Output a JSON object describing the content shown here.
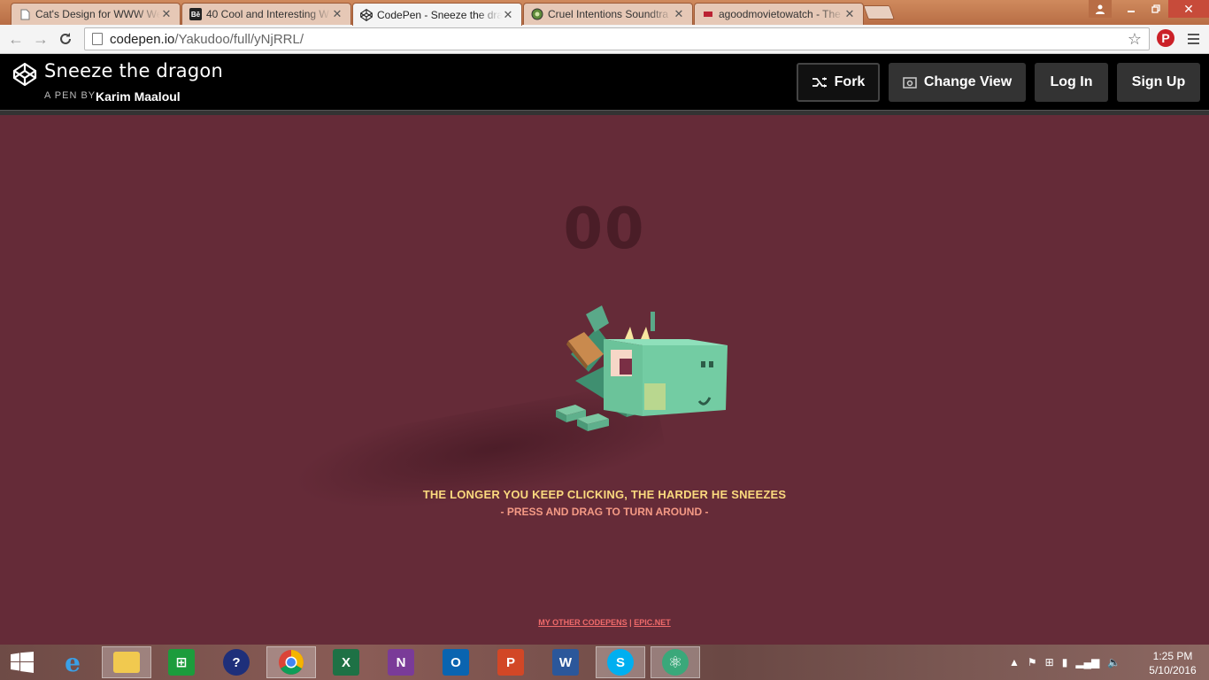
{
  "browser": {
    "tabs": [
      {
        "title": "Cat's Design for WWW We",
        "favicon": "page-icon",
        "active": false
      },
      {
        "title": "40 Cool and Interesting W",
        "favicon": "behance-icon",
        "active": false
      },
      {
        "title": "CodePen - Sneeze the dra",
        "favicon": "codepen-icon",
        "active": true
      },
      {
        "title": "Cruel Intentions Soundtra",
        "favicon": "music-icon",
        "active": false
      },
      {
        "title": "agoodmovietowatch - The",
        "favicon": "movie-icon",
        "active": false
      }
    ],
    "url_host": "codepen.io",
    "url_path": "/Yakudoo/full/yNjRRL/"
  },
  "codepen": {
    "pen_title": "Sneeze the dragon",
    "by_prefix": "A PEN BY",
    "author": "Karim Maaloul",
    "buttons": {
      "fork": "Fork",
      "change_view": "Change View",
      "login": "Log In",
      "signup": "Sign Up"
    }
  },
  "stage": {
    "counter": "00",
    "hint_primary": "THE LONGER YOU KEEP CLICKING, THE HARDER HE SNEEZES",
    "hint_secondary": "- PRESS AND DRAG TO TURN AROUND -",
    "link_codepens": "MY OTHER CODEPENS",
    "link_separator": "|",
    "link_epic": "EPIC.NET"
  },
  "taskbar": {
    "apps": [
      "start",
      "internet-explorer",
      "file-explorer",
      "store",
      "help",
      "chrome",
      "excel",
      "onenote",
      "outlook",
      "powerpoint",
      "word",
      "skype",
      "atom"
    ],
    "clock_time": "1:25 PM",
    "clock_date": "5/10/2016"
  },
  "colors": {
    "stage_bg": "#652b38",
    "counter": "#4a1d27",
    "hint_primary": "#fbd97e",
    "hint_secondary": "#f59a85",
    "dragon_body": "#6bc39a"
  }
}
